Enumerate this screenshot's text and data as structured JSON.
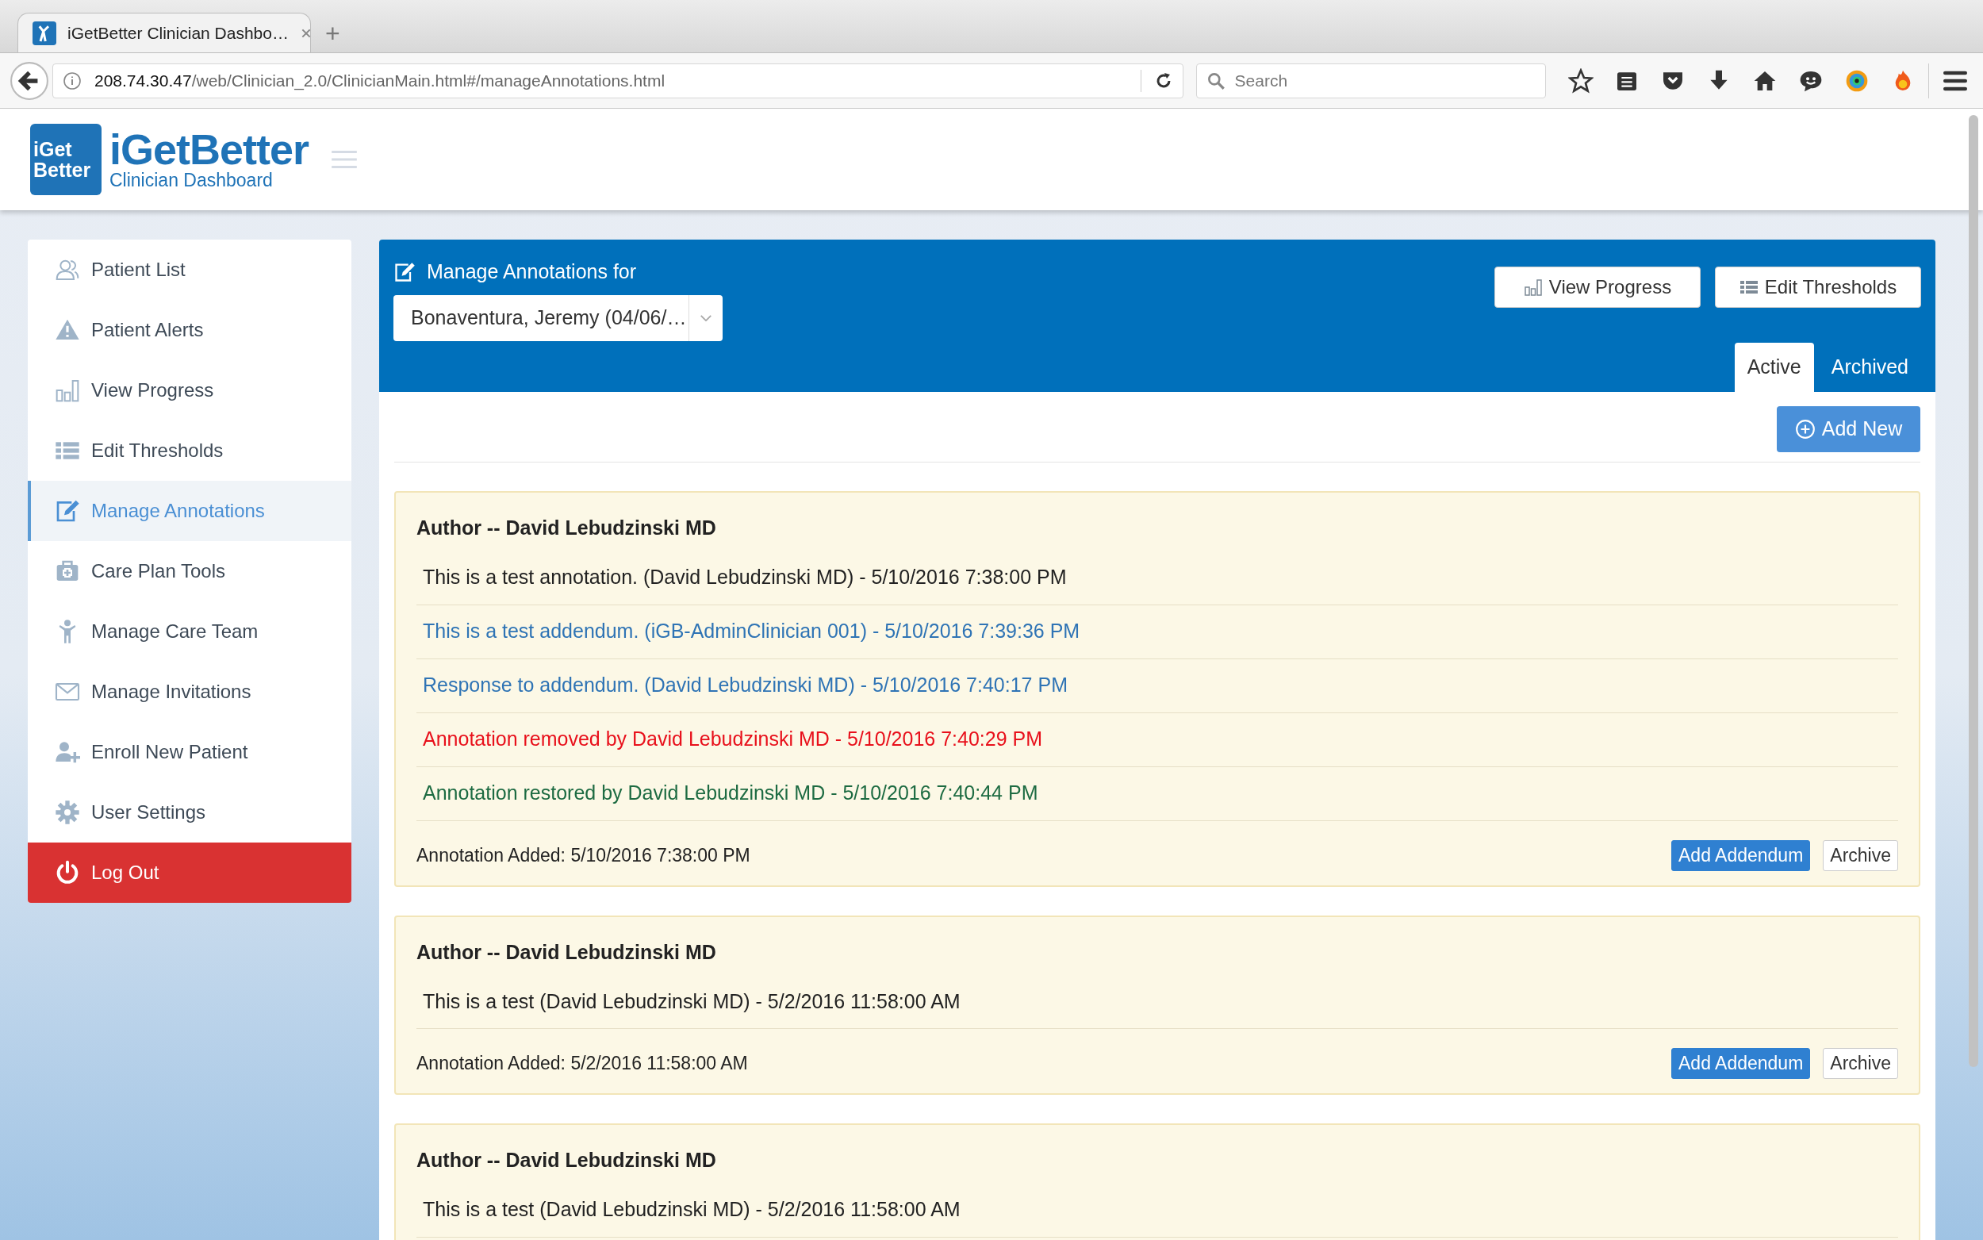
{
  "browser": {
    "tab_title": "iGetBetter Clinician Dashbo…",
    "new_tab": "+",
    "url_host": "208.74.30.47",
    "url_path": "/web/Clinician_2.0/ClinicianMain.html#/manageAnnotations.html",
    "search_placeholder": "Search"
  },
  "header": {
    "badge_lines": [
      "iGet",
      "Better"
    ],
    "name": "iGetBetter",
    "subtitle": "Clinician Dashboard"
  },
  "sidebar": {
    "items": [
      {
        "label": "Patient List",
        "kind": "nav",
        "selected": false
      },
      {
        "label": "Patient Alerts",
        "kind": "nav",
        "selected": false
      },
      {
        "label": "View Progress",
        "kind": "nav",
        "selected": false
      },
      {
        "label": "Edit Thresholds",
        "kind": "nav",
        "selected": false
      },
      {
        "label": "Manage Annotations",
        "kind": "nav",
        "selected": true
      },
      {
        "label": "Care Plan Tools",
        "kind": "nav",
        "selected": false
      },
      {
        "label": "Manage Care Team",
        "kind": "nav",
        "selected": false
      },
      {
        "label": "Manage Invitations",
        "kind": "nav",
        "selected": false
      },
      {
        "label": "Enroll New Patient",
        "kind": "nav",
        "selected": false
      },
      {
        "label": "User Settings",
        "kind": "nav",
        "selected": false
      },
      {
        "label": "Log Out",
        "kind": "logout",
        "selected": false
      }
    ]
  },
  "panel": {
    "title": "Manage Annotations for",
    "patient_select": "Bonaventura, Jeremy (04/06/…",
    "buttons": [
      "View Progress",
      "Edit Thresholds"
    ],
    "tabs": [
      {
        "label": "Active",
        "selected": true
      },
      {
        "label": "Archived",
        "selected": false
      }
    ],
    "add_button": "Add New"
  },
  "annotations": [
    {
      "author": "Author -- David Lebudzinski MD",
      "entries": [
        {
          "kind": "note",
          "text": "This is a test annotation. (David Lebudzinski MD) - 5/10/2016 7:38:00 PM"
        },
        {
          "kind": "addendum",
          "text": "This is a test addendum. (iGB-AdminClinician 001) - 5/10/2016 7:39:36 PM"
        },
        {
          "kind": "addendum",
          "text": "Response to addendum. (David Lebudzinski MD) - 5/10/2016 7:40:17 PM"
        },
        {
          "kind": "removed",
          "text": "Annotation removed by David Lebudzinski MD - 5/10/2016 7:40:29 PM"
        },
        {
          "kind": "restored",
          "text": "Annotation restored by David Lebudzinski MD - 5/10/2016 7:40:44 PM"
        }
      ],
      "added": "Annotation Added: 5/10/2016 7:38:00 PM",
      "buttons": [
        "Add Addendum",
        "Archive"
      ]
    },
    {
      "author": "Author -- David Lebudzinski MD",
      "entries": [
        {
          "kind": "note",
          "text": "This is a test (David Lebudzinski MD) - 5/2/2016 11:58:00 AM"
        }
      ],
      "added": "Annotation Added: 5/2/2016 11:58:00 AM",
      "buttons": [
        "Add Addendum",
        "Archive"
      ]
    },
    {
      "author": "Author -- David Lebudzinski MD",
      "entries": [
        {
          "kind": "note",
          "text": "This is a test (David Lebudzinski MD) - 5/2/2016 11:58:00 AM"
        }
      ]
    }
  ]
}
